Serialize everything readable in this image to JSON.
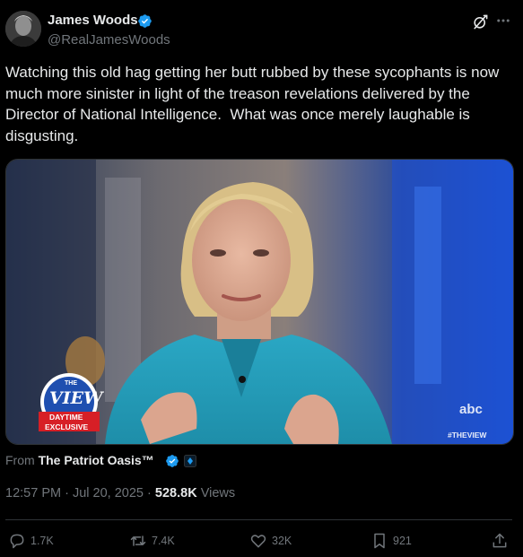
{
  "author": {
    "name": "James Woods",
    "handle": "@RealJamesWoods",
    "verified": true
  },
  "header_icons": [
    "grok-icon",
    "more-icon"
  ],
  "tweet": {
    "text": "Watching this old hag getting her butt rubbed by these sycophants is now much more sinister in light of the treason revelations delivered by the Director of National Intelligence.  What was once merely laughable is disgusting."
  },
  "media": {
    "type": "video",
    "show_logo_top": "THE",
    "show_logo_main": "VIEW",
    "show_logo_sub1": "DAYTIME",
    "show_logo_sub2": "EXCLUSIVE",
    "network_logo": "abc",
    "hashtag": "#THEVIEW"
  },
  "source": {
    "prefix": "From",
    "account": "The Patriot Oasis™"
  },
  "meta": {
    "time": "12:57 PM",
    "separator": "·",
    "date": "Jul 20, 2025",
    "views_count": "528.8K",
    "views_label": "Views"
  },
  "actions": {
    "replies": "1.7K",
    "reposts": "7.4K",
    "likes": "32K",
    "bookmarks": "921"
  },
  "colors": {
    "background": "#000000",
    "text": "#e7e9ea",
    "secondary": "#71767b",
    "verified_blue": "#1d9bf0",
    "divider": "#2f3336"
  }
}
